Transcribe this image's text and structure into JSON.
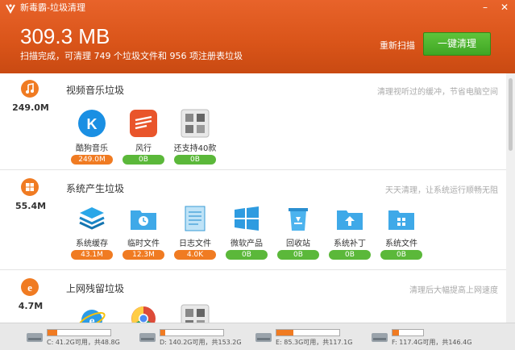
{
  "app": {
    "title": "新毒霸-垃圾清理"
  },
  "header": {
    "total_size": "309.3 MB",
    "summary": "扫描完成，可清理 749 个垃圾文件和 956 项注册表垃圾",
    "rescan_label": "重新扫描",
    "clean_label": "一键清理"
  },
  "colors": {
    "accent": "#e0591f",
    "badge_orange": "#f07b22",
    "badge_green": "#5bb83a",
    "button_green": "#4db42e"
  },
  "sections": [
    {
      "icon": "music-note-icon",
      "size": "249.0M",
      "title": "视频音乐垃圾",
      "desc": "清理视听过的缓冲，节省电脑空间",
      "items": [
        {
          "label": "酷狗音乐",
          "badge": "249.0M",
          "icon": "kugou-icon"
        },
        {
          "label": "风行",
          "badge": "0B",
          "icon": "funshion-icon"
        },
        {
          "label": "还支持40款",
          "badge": "0B",
          "icon": "more-apps-icon"
        }
      ]
    },
    {
      "icon": "windows-icon",
      "size": "55.4M",
      "title": "系统产生垃圾",
      "desc": "天天清理，让系统运行顺畅无阻",
      "items": [
        {
          "label": "系统缓存",
          "badge": "43.1M",
          "icon": "layers-icon"
        },
        {
          "label": "临时文件",
          "badge": "12.3M",
          "icon": "temp-folder-icon"
        },
        {
          "label": "日志文件",
          "badge": "4.0K",
          "icon": "notepad-icon"
        },
        {
          "label": "微软产品",
          "badge": "0B",
          "icon": "windows-tile-icon"
        },
        {
          "label": "回收站",
          "badge": "0B",
          "icon": "recycle-bin-icon"
        },
        {
          "label": "系统补丁",
          "badge": "0B",
          "icon": "patch-folder-icon"
        },
        {
          "label": "系统文件",
          "badge": "0B",
          "icon": "system-folder-icon"
        }
      ]
    },
    {
      "icon": "ie-icon",
      "size": "4.7M",
      "title": "上网残留垃圾",
      "desc": "清理后大幅提高上网速度",
      "items": []
    }
  ],
  "drives": [
    {
      "text": "C: 41.2G可用，共48.8G",
      "used_fraction": 0.16
    },
    {
      "text": "D: 140.2G可用，共153.2G",
      "used_fraction": 0.08
    },
    {
      "text": "E: 85.3G可用，共117.1G",
      "used_fraction": 0.27
    },
    {
      "text": "F: 117.4G可用，共146.4G",
      "used_fraction": 0.2
    }
  ]
}
